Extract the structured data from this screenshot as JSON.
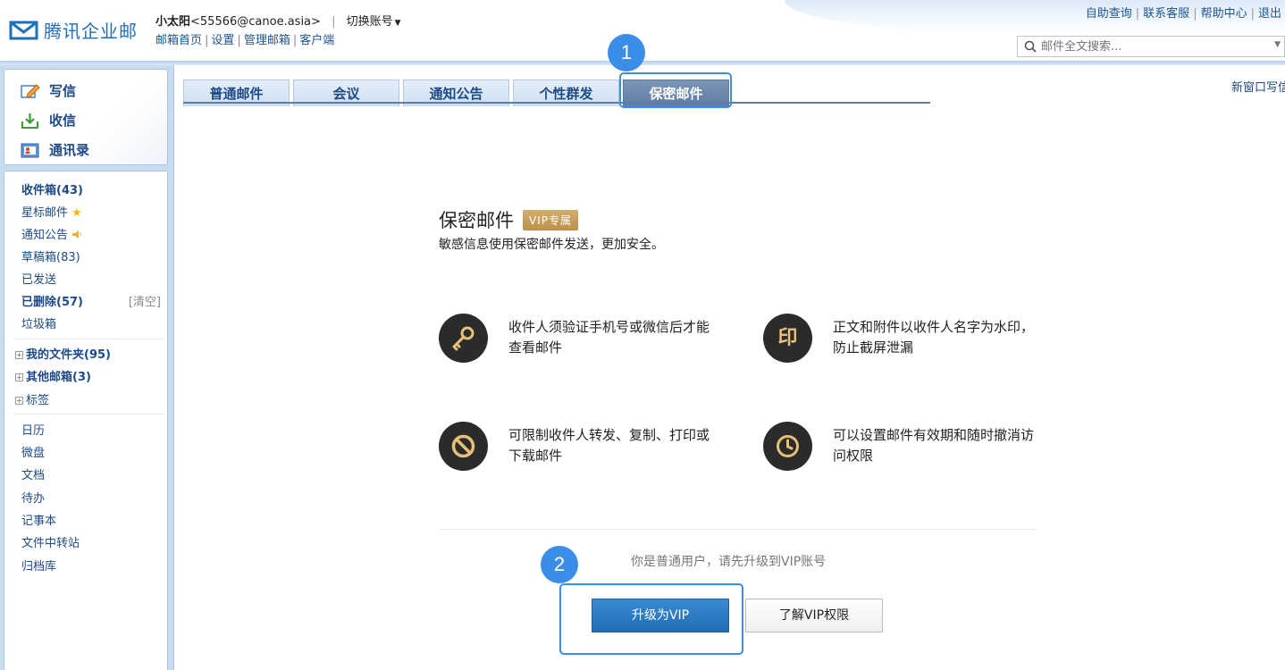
{
  "header": {
    "logo_text": "腾讯企业邮",
    "user_name": "小太阳",
    "user_email": "<55566@canoe.asia>",
    "separator": "|",
    "switch_account": "切换账号",
    "links": [
      "邮箱首页",
      "设置",
      "管理邮箱",
      "客户端"
    ],
    "top_links": [
      "自助查询",
      "联系客服",
      "帮助中心",
      "退出"
    ],
    "search_placeholder": "邮件全文搜索..."
  },
  "sidebar": {
    "quick": [
      {
        "label": "写信",
        "icon": "compose-icon"
      },
      {
        "label": "收信",
        "icon": "inbox-download-icon"
      },
      {
        "label": "通讯录",
        "icon": "contacts-icon"
      }
    ],
    "folders": [
      {
        "label": "收件箱(43)",
        "bold": true
      },
      {
        "label": "星标邮件",
        "icon": "star-icon"
      },
      {
        "label": "通知公告",
        "icon": "speaker-icon"
      },
      {
        "label": "草稿箱(83)"
      },
      {
        "label": "已发送"
      },
      {
        "label": "已删除(57)",
        "bold": true
      },
      {
        "label": "垃圾箱"
      }
    ],
    "clear_label": "[清空]",
    "tree": [
      {
        "label": "我的文件夹(95)",
        "bold": true
      },
      {
        "label": "其他邮箱(3)",
        "bold": true
      },
      {
        "label": "标签",
        "bold": false
      }
    ],
    "apps": [
      "日历",
      "微盘",
      "文档",
      "待办",
      "记事本",
      "文件中转站",
      "归档库"
    ]
  },
  "main": {
    "tabs": [
      {
        "label": "普通邮件",
        "active": false
      },
      {
        "label": "会议",
        "active": false
      },
      {
        "label": "通知公告",
        "active": false
      },
      {
        "label": "个性群发",
        "active": false
      },
      {
        "label": "保密邮件",
        "active": true
      }
    ],
    "new_window": "新窗口写信",
    "title": "保密邮件",
    "vip_badge": "VIP专属",
    "subtitle": "敏感信息使用保密邮件发送，更加安全。",
    "features": [
      {
        "icon": "key-icon",
        "text": "收件人须验证手机号或微信后才能查看邮件"
      },
      {
        "icon": "stamp-icon",
        "icon_char": "印",
        "text": "正文和附件以收件人名字为水印，防止截屏泄漏"
      },
      {
        "icon": "forbidden-icon",
        "text": "可限制收件人转发、复制、打印或下载邮件"
      },
      {
        "icon": "clock-icon",
        "text": "可以设置邮件有效期和随时撤消访问权限"
      }
    ],
    "upgrade_tip": "你是普通用户，请先升级到VIP账号",
    "btn_upgrade": "升级为VIP",
    "btn_learn": "了解VIP权限"
  },
  "annotations": {
    "badge_1": "1",
    "badge_2": "2"
  },
  "colors": {
    "accent": "#3b8ee8",
    "brand": "#1f6fb8",
    "link": "#1d4a87",
    "vip_gold": "#c79d5c",
    "upgrade_blue": "#2a7cc6"
  }
}
